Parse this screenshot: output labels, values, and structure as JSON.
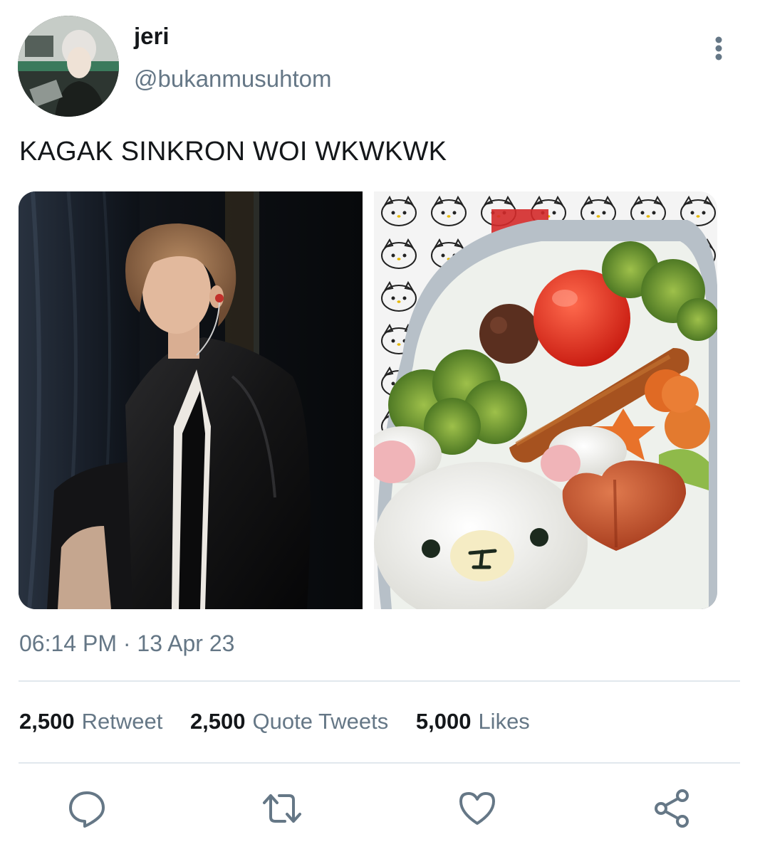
{
  "user": {
    "display_name": "jeri",
    "handle": "@bukanmusuhtom"
  },
  "tweet": {
    "text": "KAGAK SINKRON WOI WKWKWK",
    "time": "06:14 PM",
    "separator": "·",
    "date": "13 Apr 23"
  },
  "stats": {
    "retweets": {
      "count": "2,500",
      "label": "Retweet"
    },
    "quotes": {
      "count": "2,500",
      "label": "Quote Tweets"
    },
    "likes": {
      "count": "5,000",
      "label": "Likes"
    }
  },
  "media": {
    "left_image": "concert-performer-photo",
    "right_image": "bear-bento-box-photo"
  },
  "actions": [
    "reply-icon",
    "retweet-icon",
    "like-icon",
    "share-icon"
  ],
  "colors": {
    "primary_text": "#14171a",
    "secondary_text": "#657786",
    "divider": "#e1e8ed"
  }
}
